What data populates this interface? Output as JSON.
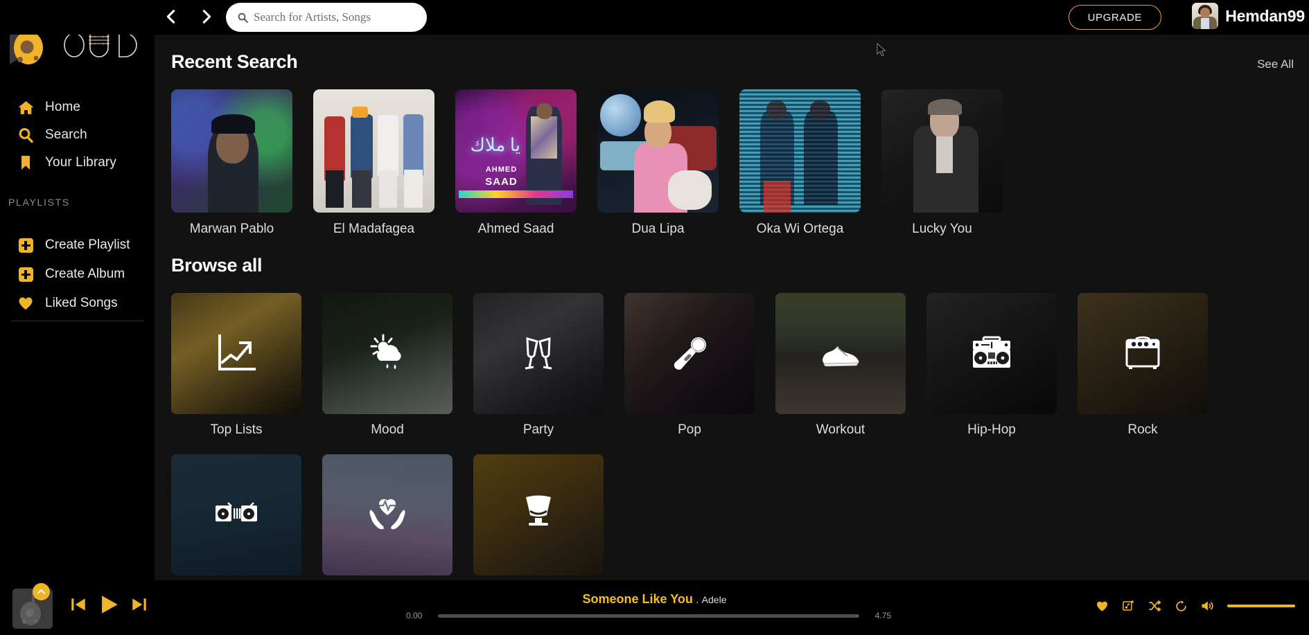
{
  "app": {
    "name": "OUD",
    "logo_letters": [
      "O",
      "U",
      "D"
    ],
    "accent": "#f0b429",
    "bg_sidebar": "#000000",
    "bg_main": "#121212",
    "bg_player": "#000000"
  },
  "topbar": {
    "back_icon": "chevron-left-icon",
    "forward_icon": "chevron-right-icon",
    "search": {
      "icon": "search-icon",
      "value": "",
      "placeholder": "Search for Artists, Songs"
    },
    "upgrade_label": "UPGRADE",
    "user": {
      "name": "Hemdan99",
      "avatar_icon": "avatar"
    }
  },
  "sidebar": {
    "nav": [
      {
        "label": "Home",
        "icon": "home-icon"
      },
      {
        "label": "Search",
        "icon": "search-icon"
      },
      {
        "label": "Your Library",
        "icon": "bookmark-icon"
      }
    ],
    "playlists_label": "PLAYLISTS",
    "playlist_actions": [
      {
        "label": "Create Playlist",
        "icon": "plus-square-icon"
      },
      {
        "label": "Create Album",
        "icon": "plus-square-icon"
      },
      {
        "label": "Liked Songs",
        "icon": "heart-icon"
      }
    ]
  },
  "main": {
    "recent": {
      "title": "Recent Search",
      "see_all_label": "See All",
      "cards": [
        {
          "name": "Marwan Pablo"
        },
        {
          "name": "El Madafagea"
        },
        {
          "name": "Ahmed Saad"
        },
        {
          "name": "Dua Lipa"
        },
        {
          "name": "Oka Wi Ortega"
        },
        {
          "name": "Lucky You"
        }
      ]
    },
    "browse": {
      "title": "Browse all",
      "cards": [
        {
          "name": "Top Lists",
          "icon": "trending-up-chart-icon"
        },
        {
          "name": "Mood",
          "icon": "sun-cloud-rain-icon"
        },
        {
          "name": "Party",
          "icon": "champagne-glasses-icon"
        },
        {
          "name": "Pop",
          "icon": "microphone-icon"
        },
        {
          "name": "Workout",
          "icon": "running-shoe-icon"
        },
        {
          "name": "Hip-Hop",
          "icon": "boombox-icon"
        },
        {
          "name": "Rock",
          "icon": "guitar-amplifier-icon"
        }
      ],
      "cards_row2": [
        {
          "name": "",
          "icon": "dj-turntables-icon"
        },
        {
          "name": "",
          "icon": "hands-heart-pulse-icon"
        },
        {
          "name": "",
          "icon": "armchair-icon"
        }
      ]
    }
  },
  "player": {
    "now_playing": {
      "track": "Someone Like You",
      "separator": ".",
      "artist": "Adele",
      "thumb_icon": "album-art-oud",
      "expand_icon": "chevron-up-icon"
    },
    "transport": {
      "previous_icon": "skip-previous-icon",
      "play_icon": "play-icon",
      "next_icon": "skip-next-icon"
    },
    "seek": {
      "current_time": "0.00",
      "total_time": "4.75",
      "progress_percent": 0
    },
    "right_controls": [
      {
        "icon": "heart-icon"
      },
      {
        "icon": "add-to-playlist-icon"
      },
      {
        "icon": "shuffle-icon"
      },
      {
        "icon": "repeat-icon"
      },
      {
        "icon": "volume-icon"
      }
    ],
    "volume_percent": 100
  }
}
